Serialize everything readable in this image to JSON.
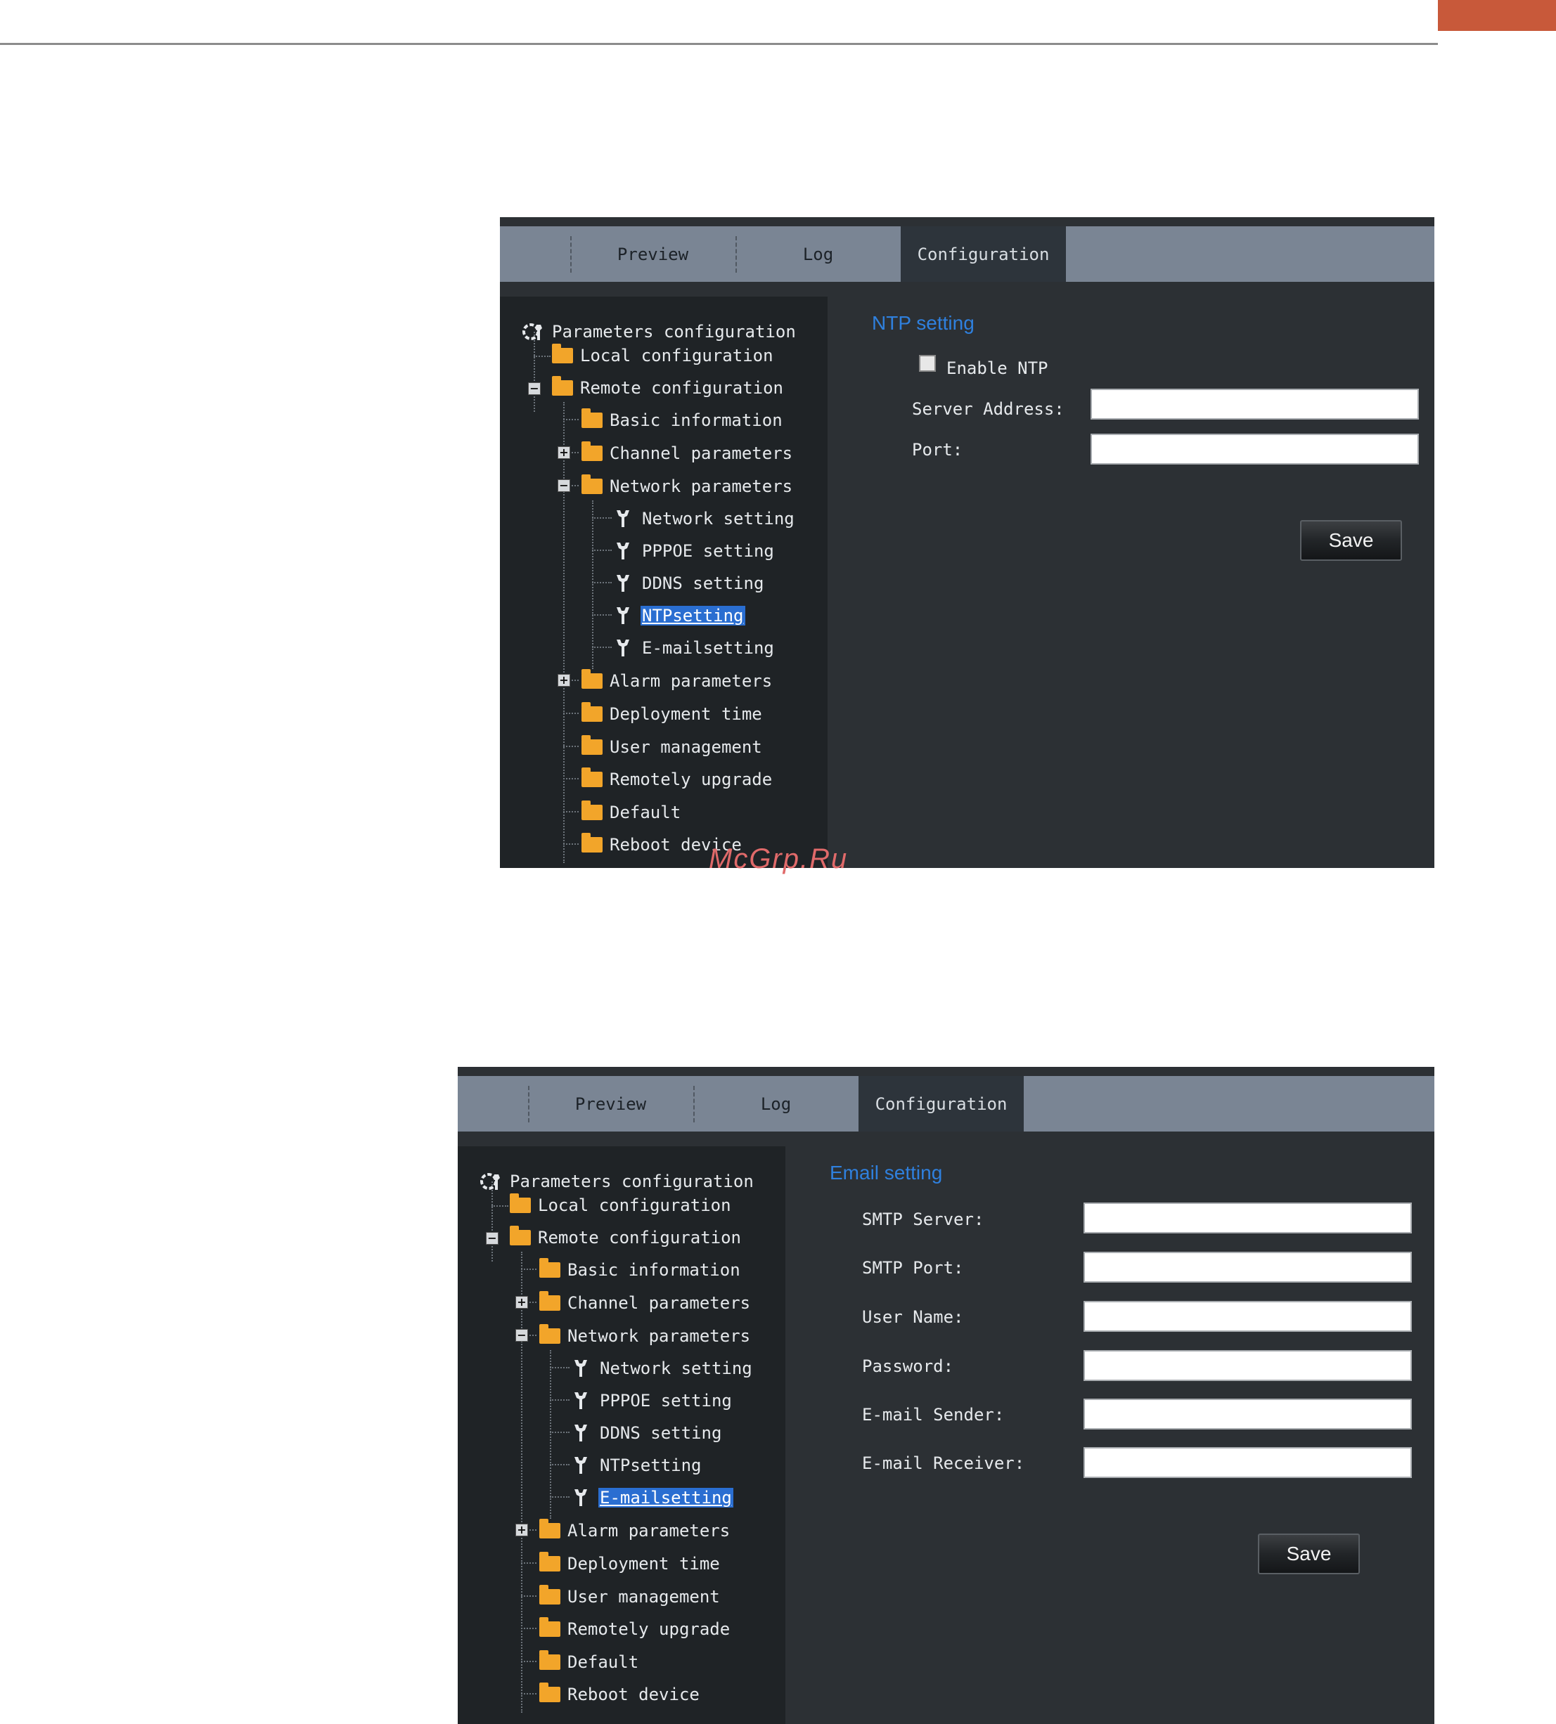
{
  "watermark": "McGrp.Ru",
  "tabs": {
    "preview": "Preview",
    "log": "Log",
    "configuration": "Configuration"
  },
  "tree": {
    "root": "Parameters configuration",
    "local": "Local configuration",
    "remote": "Remote configuration",
    "basic": "Basic information",
    "channel": "Channel parameters",
    "network": "Network parameters",
    "network_setting": "Network setting",
    "pppoe": "PPPOE setting",
    "ddns": "DDNS setting",
    "ntp": "NTPsetting",
    "email": "E-mailsetting",
    "alarm": "Alarm parameters",
    "deployment": "Deployment time",
    "user": "User management",
    "upgrade": "Remotely upgrade",
    "default": "Default",
    "reboot": "Reboot device",
    "expand_symbol": "+",
    "collapse_symbol": "−"
  },
  "ntp_panel": {
    "title": "NTP setting",
    "enable_label": "Enable NTP",
    "enabled": false,
    "server_label": "Server Address:",
    "server_value": "",
    "port_label": "Port:",
    "port_value": "",
    "save_label": "Save",
    "selected_item": "NTPsetting"
  },
  "email_panel": {
    "title": "Email setting",
    "smtp_server_label": "SMTP Server:",
    "smtp_port_label": "SMTP Port:",
    "user_name_label": "User Name:",
    "password_label": "Password:",
    "sender_label": "E-mail Sender:",
    "receiver_label": "E-mail Receiver:",
    "save_label": "Save",
    "selected_item": "E-mailsetting"
  },
  "colors": {
    "accent": "#c8593a",
    "title_blue": "#2f80de",
    "selection": "#2a6ed1",
    "panel_bg": "#2c3034",
    "tab_bar": "#7a8594"
  }
}
